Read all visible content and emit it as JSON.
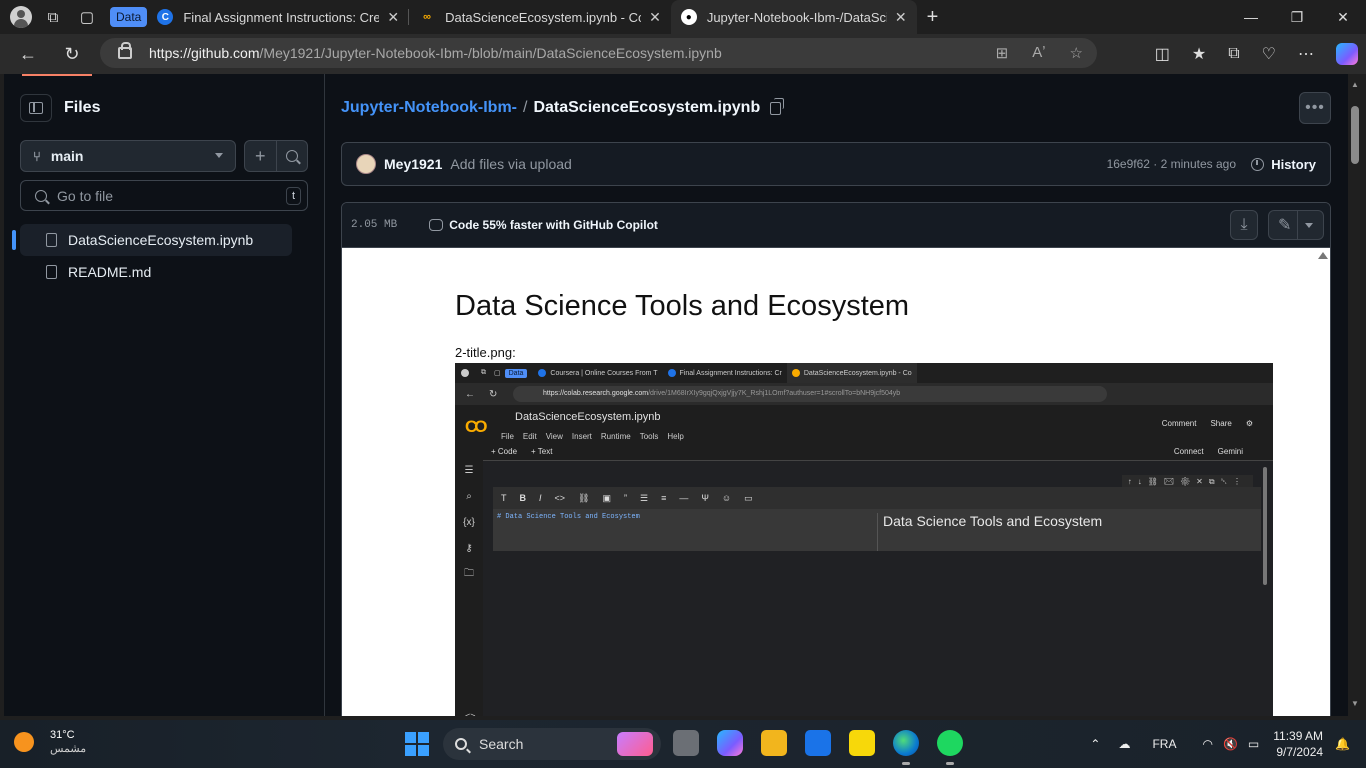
{
  "browser": {
    "tab_group_label": "Data",
    "tabs": [
      {
        "title": "Final Assignment Instructions: Cre",
        "favicon": "coursera-icon",
        "color": "#1f73e8",
        "active": false
      },
      {
        "title": "DataScienceEcosystem.ipynb - Co",
        "favicon": "colab-icon",
        "color": "#f9ab00",
        "active": false
      },
      {
        "title": "Jupyter-Notebook-Ibm-/DataScie",
        "favicon": "github-icon",
        "color": "#ffffff",
        "active": true
      }
    ],
    "url_host": "https://github.com",
    "url_path": "/Mey1921/Jupyter-Notebook-Ibm-/blob/main/DataScienceEcosystem.ipynb"
  },
  "sidebar": {
    "title": "Files",
    "branch": "main",
    "search_placeholder": "Go to file",
    "search_shortcut": "t",
    "files": [
      {
        "name": "DataScienceEcosystem.ipynb",
        "active": true
      },
      {
        "name": "README.md",
        "active": false
      }
    ]
  },
  "header": {
    "repo": "Jupyter-Notebook-Ibm-",
    "separator": "/",
    "file": "DataScienceEcosystem.ipynb"
  },
  "commit": {
    "author": "Mey1921",
    "message": "Add files via upload",
    "meta": "16e9f62 · 2 minutes ago",
    "history_label": "History"
  },
  "file_header": {
    "size": "2.05 MB",
    "copilot_text": "Code 55% faster with GitHub Copilot"
  },
  "notebook": {
    "title": "Data Science Tools and Ecosystem",
    "image_caption": "2-title.png:"
  },
  "embedded": {
    "tab_group_label": "Data",
    "tabs": [
      "Coursera | Online Courses From T",
      "Final Assignment Instructions: Cr",
      "DataScienceEcosystem.ipynb - Co"
    ],
    "url_host": "https://colab.research.google.com",
    "url_path": "/drive/1M68IrXIy9gqjQxjgVjjy7K_Rshj1LOmf?authuser=1#scrollTo=bNH9jcf504yb",
    "notebook_name": "DataScienceEcosystem.ipynb",
    "menu": [
      "File",
      "Edit",
      "View",
      "Insert",
      "Runtime",
      "Tools",
      "Help"
    ],
    "comment_label": "Comment",
    "share_label": "Share",
    "add_code": "+ Code",
    "add_text": "+ Text",
    "connect_label": "Connect",
    "gemini_label": "Gemini",
    "cell_source": "# Data Science Tools and Ecosystem",
    "cell_preview": "Data Science Tools and Ecosystem"
  },
  "taskbar": {
    "temperature": "31°C",
    "condition": "مشمس",
    "search_label": "Search",
    "language": "FRA",
    "time": "11:39 AM",
    "date": "9/7/2024"
  }
}
